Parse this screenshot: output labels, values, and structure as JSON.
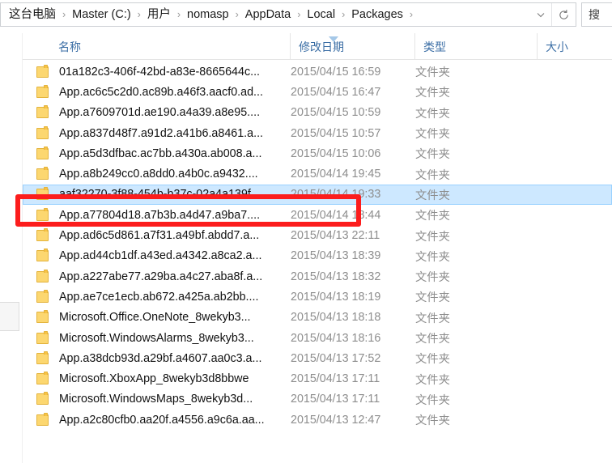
{
  "address_bar": {
    "breadcrumbs": [
      {
        "label": "这台电脑"
      },
      {
        "label": "Master (C:)"
      },
      {
        "label": "用户"
      },
      {
        "label": "nomasp"
      },
      {
        "label": "AppData"
      },
      {
        "label": "Local"
      },
      {
        "label": "Packages"
      }
    ],
    "separator": "›",
    "dropdown_icon": "chevron-down-icon",
    "refresh_icon": "refresh-icon",
    "search_placeholder": "搜"
  },
  "columns": {
    "name": "名称",
    "date_modified": "修改日期",
    "type": "类型",
    "size": "大小",
    "sort_column": "修改日期",
    "sort_direction": "descending"
  },
  "selection": {
    "selected_index": 6,
    "highlight_color": "#cde8ff",
    "annotation_color": "#fc1d1d"
  },
  "files": [
    {
      "name": "01a182c3-406f-42bd-a83e-8665644c...",
      "date": "2015/04/15 16:59",
      "type": "文件夹",
      "size": ""
    },
    {
      "name": "App.ac6c5c2d0.ac89b.a46f3.aacf0.ad...",
      "date": "2015/04/15 16:47",
      "type": "文件夹",
      "size": ""
    },
    {
      "name": "App.a7609701d.ae190.a4a39.a8e95....",
      "date": "2015/04/15 10:59",
      "type": "文件夹",
      "size": ""
    },
    {
      "name": "App.a837d48f7.a91d2.a41b6.a8461.a...",
      "date": "2015/04/15 10:57",
      "type": "文件夹",
      "size": ""
    },
    {
      "name": "App.a5d3dfbac.ac7bb.a430a.ab008.a...",
      "date": "2015/04/15 10:06",
      "type": "文件夹",
      "size": ""
    },
    {
      "name": "App.a8b249cc0.a8dd0.a4b0c.a9432....",
      "date": "2015/04/14 19:45",
      "type": "文件夹",
      "size": ""
    },
    {
      "name": "aaf32270-3f88-454b-b37c-02a4a139f...",
      "date": "2015/04/14 19:33",
      "type": "文件夹",
      "size": ""
    },
    {
      "name": "App.a77804d18.a7b3b.a4d47.a9ba7....",
      "date": "2015/04/14 18:44",
      "type": "文件夹",
      "size": ""
    },
    {
      "name": "App.ad6c5d861.a7f31.a49bf.abdd7.a...",
      "date": "2015/04/13 22:11",
      "type": "文件夹",
      "size": ""
    },
    {
      "name": "App.ad44cb1df.a43ed.a4342.a8ca2.a...",
      "date": "2015/04/13 18:39",
      "type": "文件夹",
      "size": ""
    },
    {
      "name": "App.a227abe77.a29ba.a4c27.aba8f.a...",
      "date": "2015/04/13 18:32",
      "type": "文件夹",
      "size": ""
    },
    {
      "name": "App.ae7ce1ecb.ab672.a425a.ab2bb....",
      "date": "2015/04/13 18:19",
      "type": "文件夹",
      "size": ""
    },
    {
      "name": "Microsoft.Office.OneNote_8wekyb3...",
      "date": "2015/04/13 18:18",
      "type": "文件夹",
      "size": ""
    },
    {
      "name": "Microsoft.WindowsAlarms_8wekyb3...",
      "date": "2015/04/13 18:16",
      "type": "文件夹",
      "size": ""
    },
    {
      "name": "App.a38dcb93d.a29bf.a4607.aa0c3.a...",
      "date": "2015/04/13 17:52",
      "type": "文件夹",
      "size": ""
    },
    {
      "name": "Microsoft.XboxApp_8wekyb3d8bbwe",
      "date": "2015/04/13 17:11",
      "type": "文件夹",
      "size": ""
    },
    {
      "name": "Microsoft.WindowsMaps_8wekyb3d...",
      "date": "2015/04/13 17:11",
      "type": "文件夹",
      "size": ""
    },
    {
      "name": "App.a2c80cfb0.aa20f.a4556.a9c6a.aa...",
      "date": "2015/04/13 12:47",
      "type": "文件夹",
      "size": ""
    }
  ]
}
